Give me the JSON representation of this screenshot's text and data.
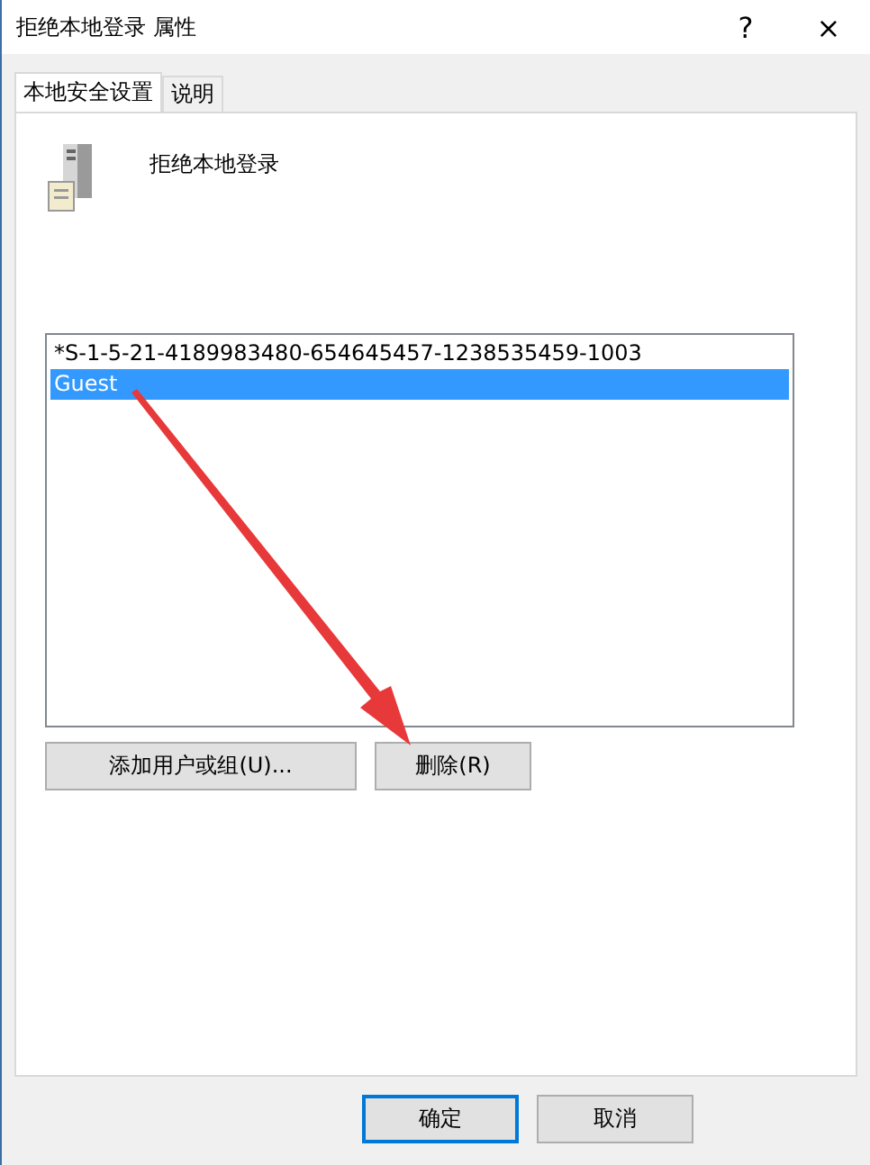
{
  "window": {
    "title": "拒绝本地登录 属性",
    "help": "?",
    "close": "×"
  },
  "tabs": [
    {
      "label": "本地安全设置",
      "selected": true
    },
    {
      "label": "说明",
      "selected": false
    }
  ],
  "policy": {
    "name": "拒绝本地登录"
  },
  "accounts": [
    {
      "name": "*S-1-5-21-4189983480-654645457-1238535459-1003",
      "selected": false
    },
    {
      "name": "Guest",
      "selected": true
    }
  ],
  "list_buttons": [
    "添加用户或组(U)...",
    "删除(R)"
  ],
  "buttons": [
    {
      "label": "确定",
      "default": true
    },
    {
      "label": "取消",
      "default": false
    }
  ],
  "annotation": {
    "kind": "arrow"
  }
}
